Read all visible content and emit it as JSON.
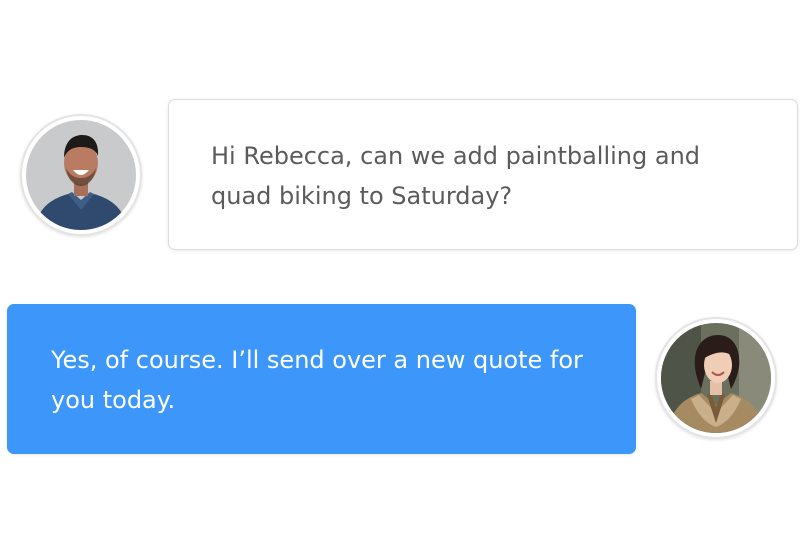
{
  "conversation": {
    "messages": [
      {
        "sender": "incoming",
        "avatar_icon": "man-avatar-icon",
        "text": "Hi Rebecca, can we add paintballing and quad biking to Saturday?"
      },
      {
        "sender": "outgoing",
        "avatar_icon": "woman-avatar-icon",
        "text": "Yes, of course. I’ll send over a new quote for you today."
      }
    ]
  },
  "colors": {
    "outgoing_bubble": "#3d97fb",
    "incoming_text": "#5b5b5b",
    "incoming_border": "#dcdcdc"
  }
}
